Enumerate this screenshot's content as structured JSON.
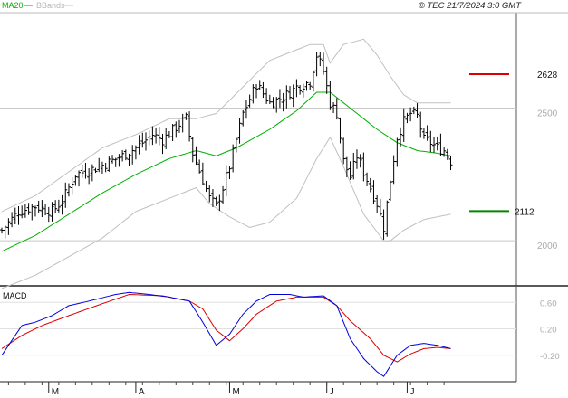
{
  "header": {
    "legend_ma": "MA20",
    "legend_bb": "BBands",
    "copyright": "© TEC 21/7/2024 3:0 GMT"
  },
  "macd_panel": {
    "label": "MACD"
  },
  "x_axis": {
    "month_labels": [
      "M",
      "A",
      "M",
      "J",
      "J"
    ]
  },
  "colors": {
    "price": "#000000",
    "ma20": "#00b000",
    "bbands": "#c0c0c0",
    "macd": "#0000dd",
    "signal": "#dd0000",
    "resistance": "#dd0000",
    "support": "#008800",
    "grid": "#c8c8c8"
  },
  "chart_data": [
    {
      "type": "candlestick",
      "title": "",
      "ylim": [
        1830,
        2860
      ],
      "y_ticks": [
        2000,
        2500
      ],
      "y_tick_labels": [
        "2000",
        "2500"
      ],
      "levels": [
        {
          "name": "resistance",
          "value": 2628,
          "label": "2628"
        },
        {
          "name": "support",
          "value": 2112,
          "label": "2112"
        }
      ],
      "bars_count": 140,
      "close_anchors": [
        [
          0,
          2040
        ],
        [
          5,
          2110
        ],
        [
          10,
          2130
        ],
        [
          15,
          2110
        ],
        [
          18,
          2150
        ],
        [
          22,
          2250
        ],
        [
          27,
          2270
        ],
        [
          31,
          2290
        ],
        [
          36,
          2320
        ],
        [
          40,
          2350
        ],
        [
          45,
          2400
        ],
        [
          48,
          2380
        ],
        [
          53,
          2440
        ],
        [
          55,
          2460
        ],
        [
          57,
          2330
        ],
        [
          60,
          2230
        ],
        [
          62,
          2160
        ],
        [
          64,
          2130
        ],
        [
          66,
          2200
        ],
        [
          68,
          2280
        ],
        [
          72,
          2480
        ],
        [
          76,
          2590
        ],
        [
          80,
          2520
        ],
        [
          84,
          2540
        ],
        [
          88,
          2580
        ],
        [
          92,
          2600
        ],
        [
          94,
          2700
        ],
        [
          96,
          2640
        ],
        [
          98,
          2520
        ],
        [
          100,
          2480
        ],
        [
          102,
          2300
        ],
        [
          104,
          2240
        ],
        [
          106,
          2320
        ],
        [
          108,
          2260
        ],
        [
          112,
          2140
        ],
        [
          114,
          2050
        ],
        [
          116,
          2230
        ],
        [
          118,
          2390
        ],
        [
          120,
          2450
        ],
        [
          122,
          2480
        ],
        [
          124,
          2470
        ],
        [
          126,
          2380
        ],
        [
          128,
          2370
        ],
        [
          130,
          2350
        ],
        [
          132,
          2340
        ],
        [
          134,
          2300
        ]
      ],
      "ma20_anchors": [
        [
          0,
          1960
        ],
        [
          10,
          2020
        ],
        [
          20,
          2100
        ],
        [
          30,
          2180
        ],
        [
          40,
          2250
        ],
        [
          50,
          2310
        ],
        [
          58,
          2340
        ],
        [
          64,
          2320
        ],
        [
          70,
          2350
        ],
        [
          80,
          2420
        ],
        [
          88,
          2490
        ],
        [
          94,
          2560
        ],
        [
          98,
          2560
        ],
        [
          104,
          2500
        ],
        [
          112,
          2420
        ],
        [
          118,
          2370
        ],
        [
          124,
          2340
        ],
        [
          130,
          2330
        ],
        [
          134,
          2320
        ]
      ],
      "bb_upper_anchors": [
        [
          0,
          2110
        ],
        [
          10,
          2170
        ],
        [
          20,
          2260
        ],
        [
          30,
          2350
        ],
        [
          40,
          2400
        ],
        [
          50,
          2460
        ],
        [
          58,
          2460
        ],
        [
          64,
          2480
        ],
        [
          72,
          2580
        ],
        [
          80,
          2680
        ],
        [
          88,
          2720
        ],
        [
          92,
          2740
        ],
        [
          96,
          2740
        ],
        [
          98,
          2670
        ],
        [
          102,
          2740
        ],
        [
          108,
          2760
        ],
        [
          112,
          2700
        ],
        [
          116,
          2620
        ],
        [
          120,
          2550
        ],
        [
          124,
          2520
        ],
        [
          130,
          2520
        ],
        [
          134,
          2520
        ]
      ],
      "bb_lower_anchors": [
        [
          0,
          1820
        ],
        [
          10,
          1870
        ],
        [
          20,
          1940
        ],
        [
          30,
          2010
        ],
        [
          40,
          2110
        ],
        [
          50,
          2160
        ],
        [
          58,
          2200
        ],
        [
          62,
          2140
        ],
        [
          68,
          2090
        ],
        [
          74,
          2050
        ],
        [
          80,
          2070
        ],
        [
          88,
          2160
        ],
        [
          94,
          2310
        ],
        [
          98,
          2390
        ],
        [
          102,
          2280
        ],
        [
          108,
          2100
        ],
        [
          114,
          2000
        ],
        [
          116,
          2000
        ],
        [
          120,
          2040
        ],
        [
          126,
          2080
        ],
        [
          134,
          2100
        ]
      ]
    },
    {
      "type": "line",
      "title": "MACD",
      "ylim": [
        -0.6,
        0.85
      ],
      "y_ticks": [
        0.6,
        0.2,
        -0.2
      ],
      "y_tick_labels": [
        "0.60",
        "0.20",
        "-0.20"
      ],
      "series": [
        {
          "name": "MACD",
          "anchors": [
            [
              0,
              -0.2
            ],
            [
              6,
              0.25
            ],
            [
              10,
              0.3
            ],
            [
              15,
              0.4
            ],
            [
              20,
              0.55
            ],
            [
              26,
              0.62
            ],
            [
              34,
              0.72
            ],
            [
              38,
              0.75
            ],
            [
              44,
              0.72
            ],
            [
              50,
              0.68
            ],
            [
              56,
              0.62
            ],
            [
              60,
              0.3
            ],
            [
              64,
              -0.05
            ],
            [
              68,
              0.12
            ],
            [
              72,
              0.42
            ],
            [
              76,
              0.62
            ],
            [
              80,
              0.72
            ],
            [
              86,
              0.72
            ],
            [
              90,
              0.68
            ],
            [
              96,
              0.7
            ],
            [
              100,
              0.55
            ],
            [
              104,
              0.05
            ],
            [
              108,
              -0.25
            ],
            [
              112,
              -0.45
            ],
            [
              114,
              -0.52
            ],
            [
              118,
              -0.2
            ],
            [
              122,
              -0.05
            ],
            [
              126,
              -0.02
            ],
            [
              130,
              -0.05
            ],
            [
              134,
              -0.1
            ]
          ]
        },
        {
          "name": "Signal",
          "anchors": [
            [
              0,
              -0.1
            ],
            [
              6,
              0.1
            ],
            [
              12,
              0.25
            ],
            [
              20,
              0.4
            ],
            [
              30,
              0.58
            ],
            [
              38,
              0.72
            ],
            [
              48,
              0.7
            ],
            [
              56,
              0.62
            ],
            [
              60,
              0.5
            ],
            [
              64,
              0.18
            ],
            [
              68,
              0.02
            ],
            [
              72,
              0.2
            ],
            [
              76,
              0.42
            ],
            [
              82,
              0.62
            ],
            [
              88,
              0.68
            ],
            [
              96,
              0.68
            ],
            [
              100,
              0.55
            ],
            [
              104,
              0.32
            ],
            [
              110,
              0.05
            ],
            [
              114,
              -0.2
            ],
            [
              118,
              -0.3
            ],
            [
              122,
              -0.18
            ],
            [
              126,
              -0.1
            ],
            [
              130,
              -0.08
            ],
            [
              134,
              -0.1
            ]
          ]
        }
      ]
    }
  ]
}
